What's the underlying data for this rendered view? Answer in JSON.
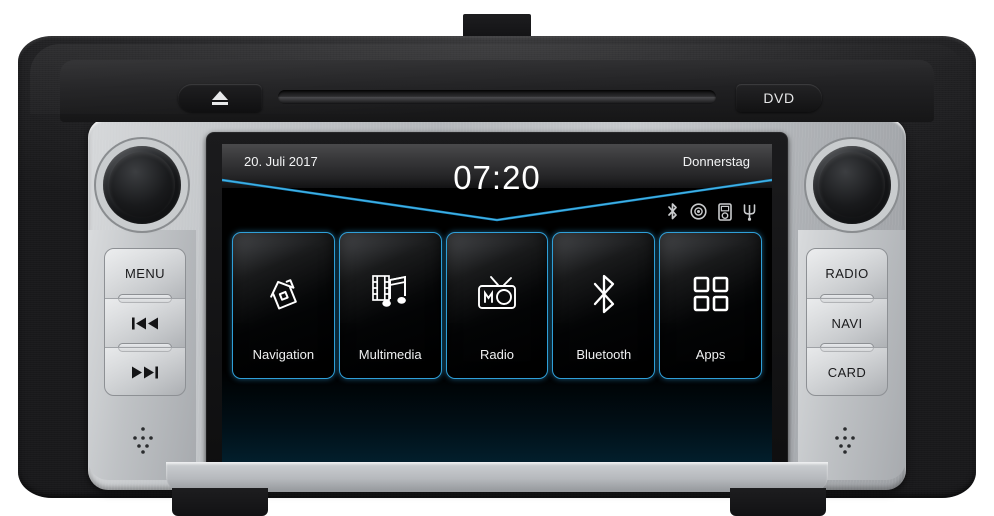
{
  "device": {
    "type": "car-infotainment-head-unit",
    "top_bezel": {
      "eject_label": "eject-icon",
      "disc_slot_label": "disc-slot",
      "dvd_label": "DVD"
    },
    "knobs": {
      "left_name": "volume-power-knob",
      "right_name": "tune-select-knob"
    },
    "left_buttons": [
      {
        "label": "MENU",
        "name": "menu-button",
        "icon": ""
      },
      {
        "label": "",
        "name": "previous-track-button",
        "icon": "prev-track-icon"
      },
      {
        "label": "",
        "name": "next-track-button",
        "icon": "next-track-icon"
      }
    ],
    "right_buttons": [
      {
        "label": "RADIO",
        "name": "radio-button",
        "icon": ""
      },
      {
        "label": "NAVI",
        "name": "navi-button",
        "icon": ""
      },
      {
        "label": "CARD",
        "name": "card-button",
        "icon": ""
      }
    ],
    "dot_pads": {
      "left_name": "microphone-dot-pad",
      "right_name": "reset-dot-pad"
    }
  },
  "screen": {
    "header": {
      "date": "20. Juli 2017",
      "time": "07:20",
      "weekday": "Donnerstag"
    },
    "status_icons": [
      {
        "name": "bluetooth-icon",
        "label": "Bluetooth"
      },
      {
        "name": "disc-icon",
        "label": "Disc"
      },
      {
        "name": "ipod-icon",
        "label": "iPod"
      },
      {
        "name": "usb-icon",
        "label": "USB"
      }
    ],
    "tiles": [
      {
        "label": "Navigation",
        "name": "tile-navigation",
        "icon": "navigation-house-icon"
      },
      {
        "label": "Multimedia",
        "name": "tile-multimedia",
        "icon": "film-music-icon"
      },
      {
        "label": "Radio",
        "name": "tile-radio",
        "icon": "radio-icon"
      },
      {
        "label": "Bluetooth",
        "name": "tile-bluetooth",
        "icon": "bluetooth-icon"
      },
      {
        "label": "Apps",
        "name": "tile-apps",
        "icon": "grid-apps-icon"
      }
    ]
  },
  "colors": {
    "accent_blue": "#2f9fd8",
    "screen_black": "#000000",
    "faceplate_silver": "#c2c5c8",
    "trim_dark": "#242426",
    "text_white": "#f2f3f4"
  }
}
